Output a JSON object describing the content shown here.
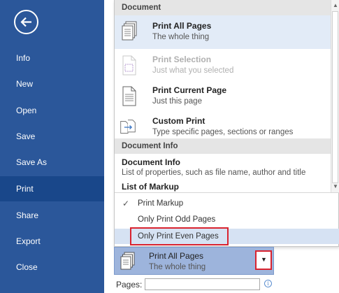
{
  "sidebar": {
    "items": [
      {
        "label": "Info"
      },
      {
        "label": "New"
      },
      {
        "label": "Open"
      },
      {
        "label": "Save"
      },
      {
        "label": "Save As"
      },
      {
        "label": "Print",
        "active": true
      },
      {
        "label": "Share"
      },
      {
        "label": "Export"
      },
      {
        "label": "Close"
      }
    ],
    "color": "#2b579a",
    "active_color": "#19478a"
  },
  "dropdown": {
    "section_document": "Document",
    "options": [
      {
        "title": "Print All Pages",
        "desc": "The whole thing",
        "icon": "all-pages-icon"
      },
      {
        "title": "Print Selection",
        "desc": "Just what you selected",
        "icon": "selection-icon",
        "disabled": true
      },
      {
        "title": "Print Current Page",
        "desc": "Just this page",
        "icon": "current-page-icon"
      },
      {
        "title": "Custom Print",
        "desc": "Type specific pages, sections or ranges",
        "icon": "custom-print-icon"
      }
    ],
    "section_document_info": "Document Info",
    "document_info": {
      "title": "Document Info",
      "desc": "List of properties, such as file name, author and title"
    },
    "list_of_markup": {
      "title": "List of Markup"
    },
    "checks": [
      {
        "label": "Print Markup",
        "checked": true
      },
      {
        "label": "Only Print Odd Pages",
        "checked": false
      },
      {
        "label": "Only Print Even Pages",
        "checked": false,
        "selected": true
      }
    ]
  },
  "range": {
    "title": "Print All Pages",
    "desc": "The whole thing"
  },
  "pages": {
    "label": "Pages:",
    "value": ""
  },
  "colors": {
    "highlight_border": "#d9232f",
    "selection": "#9db4dc"
  }
}
